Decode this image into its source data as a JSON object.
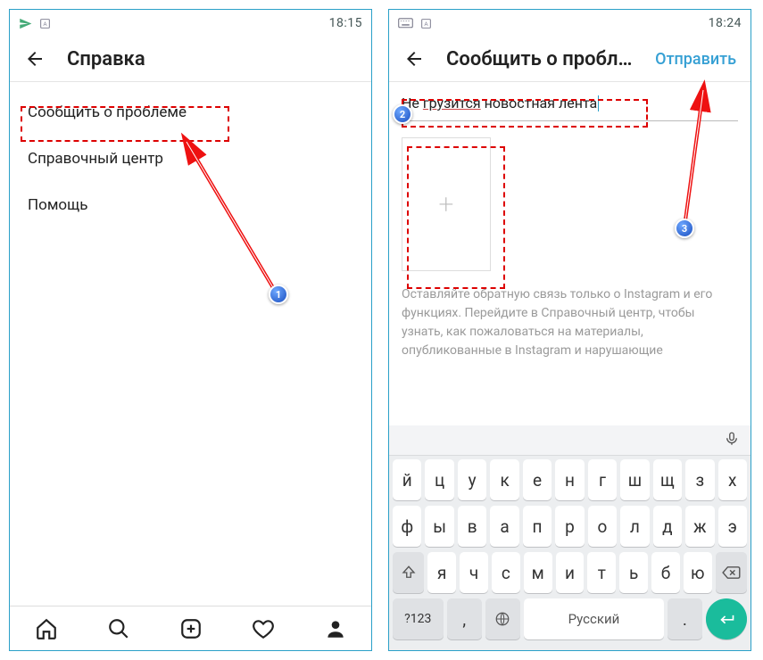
{
  "left": {
    "status": {
      "time": "18:15"
    },
    "app_bar": {
      "title": "Справка"
    },
    "menu": [
      {
        "label": "Сообщить  о проблеме"
      },
      {
        "label": "Справочный центр"
      },
      {
        "label": "Помощь"
      }
    ],
    "badge": "1"
  },
  "right": {
    "status": {
      "time": "18:24"
    },
    "app_bar": {
      "title": "Сообщить о пробл…",
      "action": "Отправить"
    },
    "report": {
      "text_prefix": "Не ",
      "text_underlined": "грузится",
      "text_suffix": " новостная лента"
    },
    "disclaimer": "Оставляйте обратную связь только о Instagram и его функциях. Перейдите в Справочный центр, чтобы узнать, как пожаловаться на материалы, опубликованные в Instagram и нарушающие",
    "keyboard": {
      "row1": [
        "й",
        "ц",
        "у",
        "к",
        "е",
        "н",
        "г",
        "ш",
        "щ",
        "з",
        "х"
      ],
      "row2": [
        "ф",
        "ы",
        "в",
        "а",
        "п",
        "р",
        "о",
        "л",
        "д",
        "ж",
        "э"
      ],
      "row3": [
        "я",
        "ч",
        "с",
        "м",
        "и",
        "т",
        "ь",
        "б",
        "ю"
      ],
      "numeric_label": "?123",
      "space_label": "Русский"
    },
    "badge2": "2",
    "badge3": "3"
  }
}
